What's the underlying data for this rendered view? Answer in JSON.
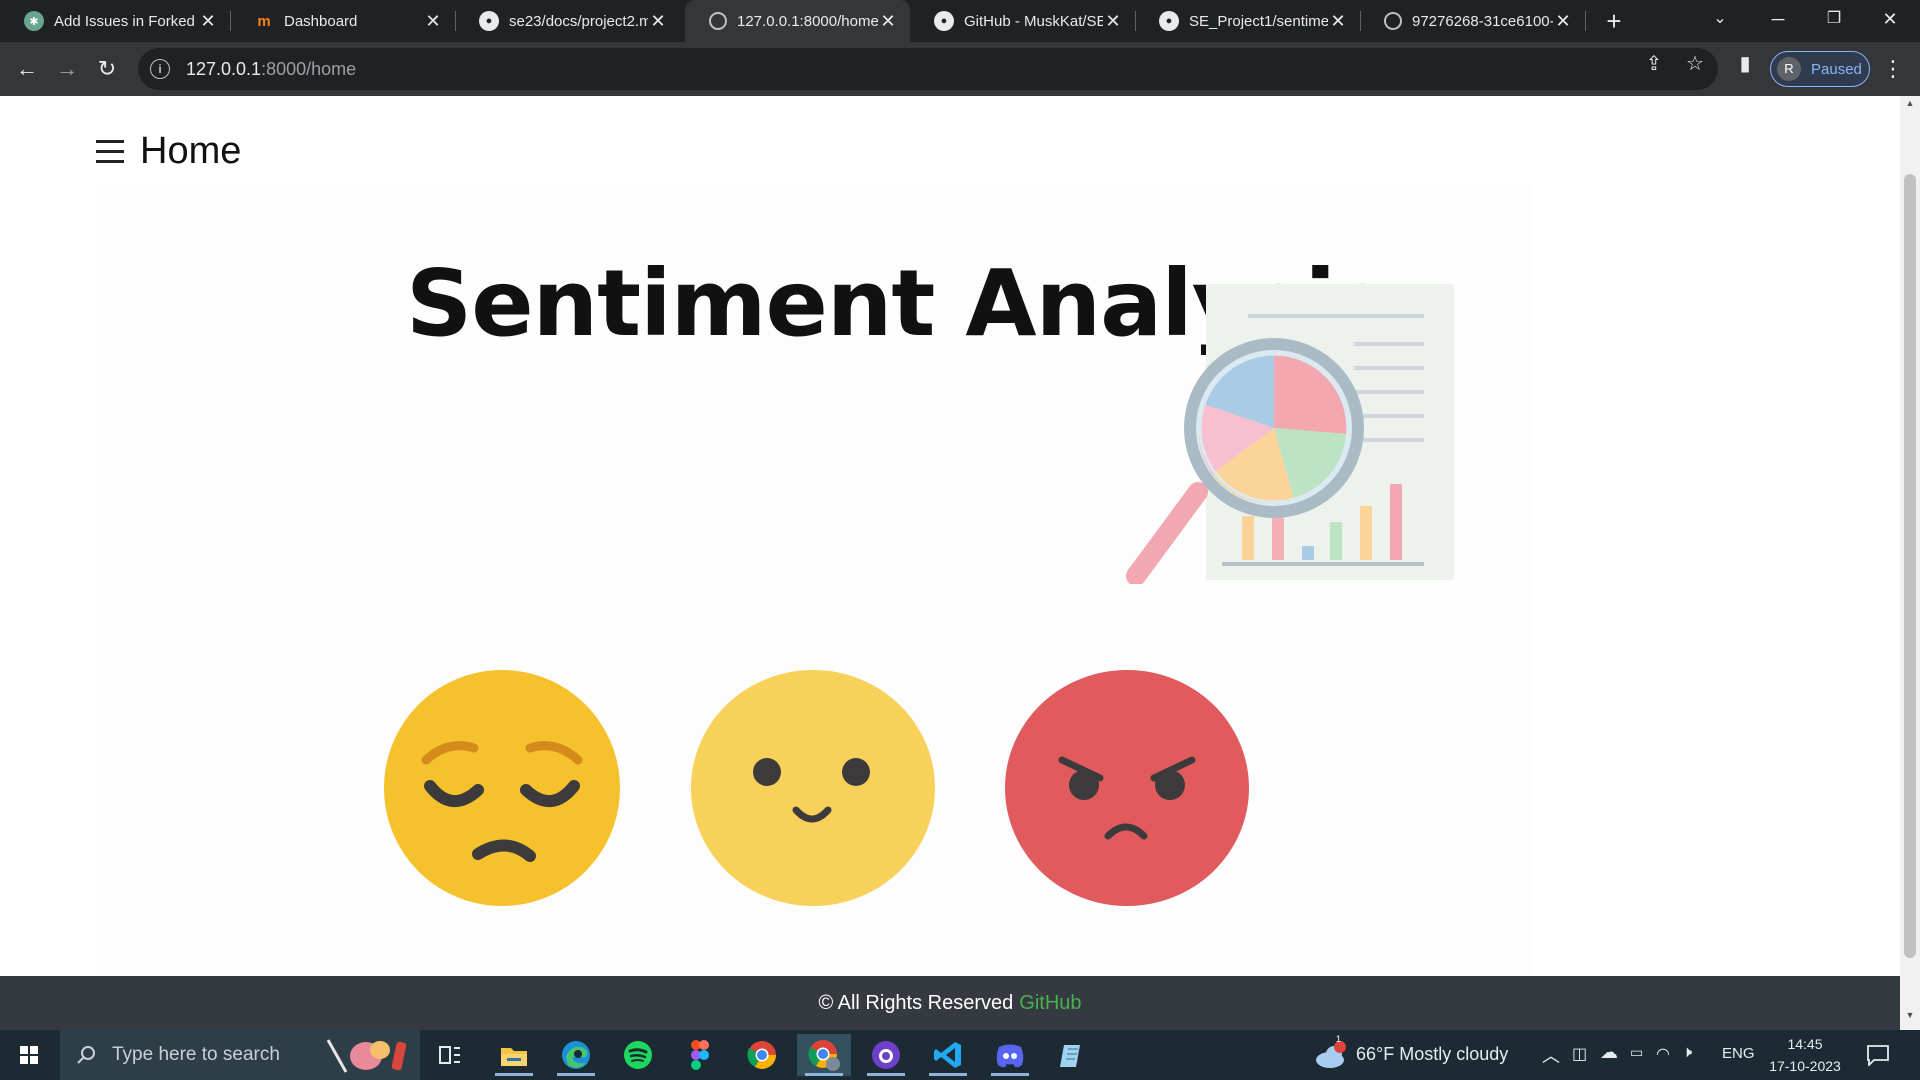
{
  "browser": {
    "tabs": [
      {
        "title": "Add Issues in Forked",
        "icon": "chatgpt-icon"
      },
      {
        "title": "Dashboard",
        "icon": "moodle-icon"
      },
      {
        "title": "se23/docs/project2.m",
        "icon": "github-icon"
      },
      {
        "title": "127.0.0.1:8000/home",
        "icon": "globe-icon",
        "active": true
      },
      {
        "title": "GitHub - MuskKat/SE",
        "icon": "github-icon"
      },
      {
        "title": "SE_Project1/sentimen",
        "icon": "github-icon"
      },
      {
        "title": "97276268-31ce6100-",
        "icon": "globe-icon"
      }
    ],
    "address": {
      "host": "127.0.0.1",
      "path": ":8000/home"
    },
    "profile": {
      "initial": "R",
      "status": "Paused"
    }
  },
  "page": {
    "title": "Home",
    "hero": {
      "heading": "Sentiment Analysis",
      "faces": [
        "sad-face-icon",
        "happy-face-icon",
        "angry-face-icon"
      ]
    },
    "footer": {
      "text": "© All Rights Reserved",
      "link": "GitHub"
    }
  },
  "taskbar": {
    "search_placeholder": "Type here to search",
    "weather": {
      "temp": "66°F",
      "condition": "Mostly cloudy",
      "badge": "1"
    },
    "language": "ENG",
    "time": "14:45",
    "date": "17-10-2023"
  },
  "colors": {
    "accent_link": "#4caf50",
    "face_yellow": "#f5c22e",
    "face_light_yellow": "#f8d15b",
    "face_red": "#e05a5e"
  }
}
